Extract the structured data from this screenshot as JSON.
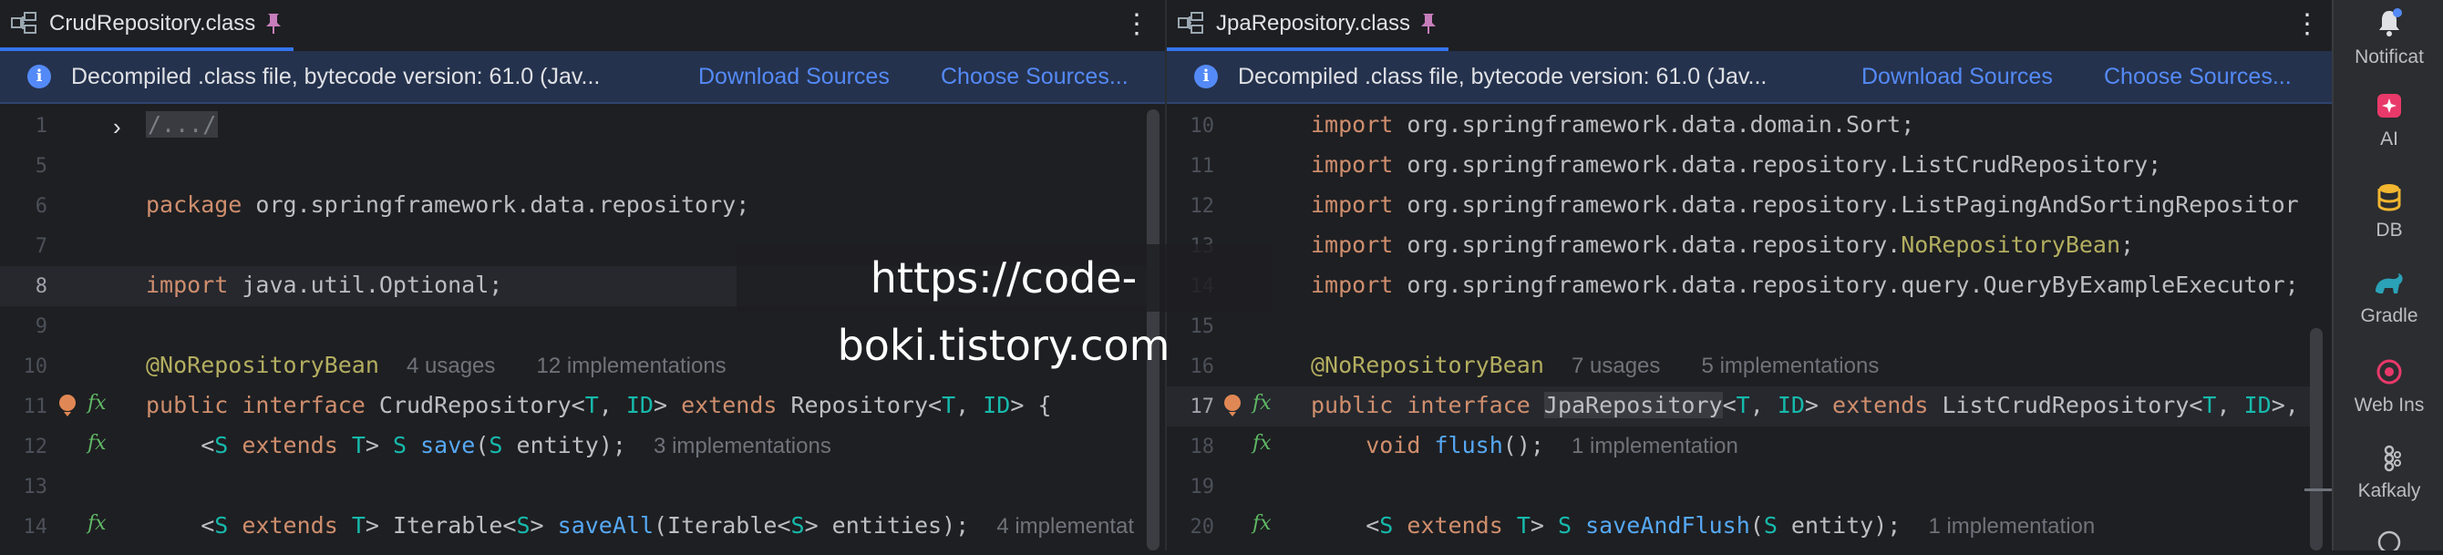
{
  "left": {
    "tab_title": "CrudRepository.class",
    "banner_text": "Decompiled .class file, bytecode version: 61.0 (Jav...",
    "download_sources": "Download Sources",
    "choose_sources": "Choose Sources...",
    "lines": {
      "l1": "1",
      "l5": "5",
      "l6": "6",
      "l7": "7",
      "l8": "8",
      "l9": "9",
      "l10": "10",
      "l11": "11",
      "l12": "12",
      "l13": "13",
      "l14": "14"
    },
    "code": {
      "fold": "/.../",
      "package_kw": "package",
      "package_name": " org.springframework.data.repository;",
      "import_kw": "import",
      "import_name": " java.util.Optional;",
      "annotation": "@NoRepositoryBean",
      "ann_usages": "4 usages",
      "ann_impls": "12 implementations",
      "l11_public": "public",
      "l11_interface": "interface",
      "l11_name": "CrudRepository<",
      "l11_T": "T",
      "l11_sep": ", ",
      "l11_ID": "ID",
      "l11_gt": "> ",
      "l11_extends": "extends",
      "l11_repo": " Repository<",
      "l11_T2": "T",
      "l11_sep2": ", ",
      "l11_ID2": "ID",
      "l11_end": "> {",
      "l12_lt": "<",
      "l12_S": "S",
      "l12_extends": "extends",
      "l12_T": "T",
      "l12_gt": "> ",
      "l12_S2": "S",
      "l12_save": "save",
      "l12_paren": "(",
      "l12_S3": "S",
      "l12_rest": " entity);",
      "l12_hint": "3 implementations",
      "l14_lt": "<",
      "l14_S": "S",
      "l14_extends": "extends",
      "l14_T": "T",
      "l14_iter": "> Iterable<",
      "l14_S2": "S",
      "l14_gt": "> ",
      "l14_saveAll": "saveAll",
      "l14_iter2": "(Iterable<",
      "l14_S3": "S",
      "l14_rest": "> entities);",
      "l14_hint": "4 implementat"
    }
  },
  "right": {
    "tab_title": "JpaRepository.class",
    "banner_text": "Decompiled .class file, bytecode version: 61.0 (Jav...",
    "download_sources": "Download Sources",
    "choose_sources": "Choose Sources...",
    "lines": {
      "l10": "10",
      "l11": "11",
      "l12": "12",
      "l13": "13",
      "l14": "14",
      "l15": "15",
      "l16": "16",
      "l17": "17",
      "l18": "18",
      "l19": "19",
      "l20": "20"
    },
    "code": {
      "import_kw": "import",
      "i10": " org.springframework.data.domain.Sort;",
      "i11": " org.springframework.data.repository.ListCrudRepository;",
      "i12": " org.springframework.data.repository.ListPagingAndSortingRepositor",
      "i13a": " org.springframework.data.repository.",
      "i13b": "NoRepositoryBean",
      "i13c": ";",
      "i14": " org.springframework.data.repository.query.QueryByExampleExecutor;",
      "annotation": "@NoRepositoryBean",
      "ann_usages": "7 usages",
      "ann_impls": "5 implementations",
      "l17_public": "public",
      "l17_interface": "interface",
      "l17_name": "JpaRepository",
      "l17_lt": "<",
      "l17_T": "T",
      "l17_sep": ", ",
      "l17_ID": "ID",
      "l17_gt": "> ",
      "l17_extends": "extends",
      "l17_list": " ListCrudRepository<",
      "l17_T2": "T",
      "l17_sep2": ", ",
      "l17_ID2": "ID",
      "l17_end": ">,",
      "l18_void": "void",
      "l18_flush": "flush",
      "l18_rest": "();",
      "l18_hint": "1 implementation",
      "l20_lt": "<",
      "l20_S": "S",
      "l20_extends": "extends",
      "l20_T": "T",
      "l20_gt": "> ",
      "l20_S2": "S",
      "l20_fn": "saveAndFlush",
      "l20_paren": "(",
      "l20_S3": "S",
      "l20_rest": " entity);",
      "l20_hint": "1 implementation"
    }
  },
  "tool_window": {
    "notifications": "Notificat",
    "ai": "AI",
    "db": "DB",
    "gradle": "Gradle",
    "web": "Web Ins",
    "kafka": "Kafkaly"
  },
  "watermark": "https://code-boki.tistory.com",
  "colors": {
    "background": "#1e1f22",
    "keyword": "#cf8e6d",
    "annotation": "#b3ae60",
    "type_param": "#16baac",
    "method": "#56a8f5",
    "link": "#548af7",
    "banner": "#25324d"
  }
}
